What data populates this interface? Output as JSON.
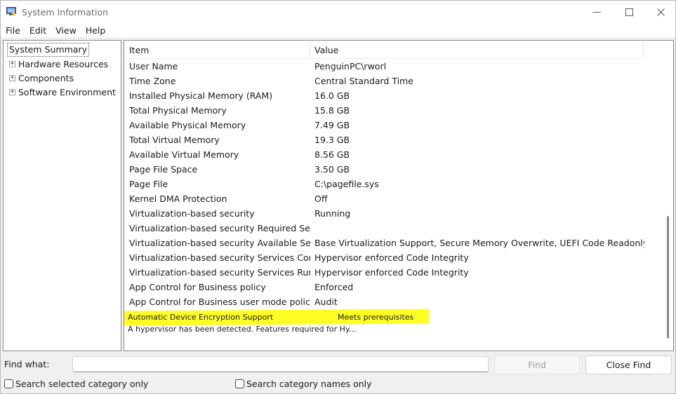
{
  "window": {
    "title": "System Information"
  },
  "menu": [
    "File",
    "Edit",
    "View",
    "Help"
  ],
  "tree": {
    "root": "System Summary",
    "nodes": [
      {
        "expander": "+",
        "label": "Hardware Resources"
      },
      {
        "expander": "+",
        "label": "Components"
      },
      {
        "expander": "+",
        "label": "Software Environment"
      }
    ]
  },
  "list": {
    "headers": {
      "item": "Item",
      "value": "Value"
    },
    "rows": [
      [
        "User Name",
        "PenguinPC\\rworl"
      ],
      [
        "Time Zone",
        "Central Standard Time"
      ],
      [
        "Installed Physical Memory (RAM)",
        "16.0 GB"
      ],
      [
        "Total Physical Memory",
        "15.8 GB"
      ],
      [
        "Available Physical Memory",
        "7.49 GB"
      ],
      [
        "Total Virtual Memory",
        "19.3 GB"
      ],
      [
        "Available Virtual Memory",
        "8.56 GB"
      ],
      [
        "Page File Space",
        "3.50 GB"
      ],
      [
        "Page File",
        "C:\\pagefile.sys"
      ],
      [
        "Kernel DMA Protection",
        "Off"
      ],
      [
        "Virtualization-based security",
        "Running"
      ],
      [
        "Virtualization-based security Required Sec...",
        ""
      ],
      [
        "Virtualization-based security Available Sec...",
        "Base Virtualization Support, Secure Memory Overwrite, UEFI Code Readonly, ..."
      ],
      [
        "Virtualization-based security Services Conf...",
        "Hypervisor enforced Code Integrity"
      ],
      [
        "Virtualization-based security Services Run...",
        "Hypervisor enforced Code Integrity"
      ],
      [
        "App Control for Business policy",
        "Enforced"
      ],
      [
        "App Control for Business user mode policy",
        "Audit"
      ]
    ],
    "highlighted_row": {
      "item": "Automatic Device Encryption Support",
      "value": "Meets prerequisites"
    },
    "description_row": "A hypervisor has been detected. Features required for Hy..."
  },
  "find": {
    "label": "Find what:",
    "value": "",
    "find_button": "Find",
    "close_find_button": "Close Find",
    "search_selected": "Search selected category only",
    "search_names": "Search category names only"
  },
  "colors": {
    "highlight": "#ffff00",
    "window_bg": "#f0f0f0"
  },
  "icons": {
    "app": "system-information-icon",
    "minimize": "minimize-icon",
    "maximize": "maximize-icon",
    "close": "close-icon"
  }
}
